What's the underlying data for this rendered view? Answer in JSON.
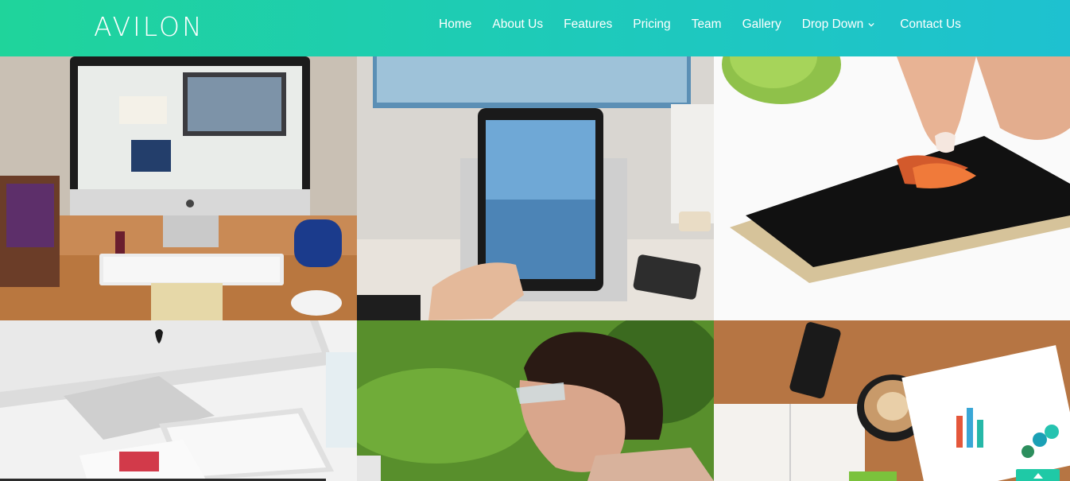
{
  "brand": {
    "name": "AVILON"
  },
  "nav": {
    "items": [
      {
        "label": "Home"
      },
      {
        "label": "About Us"
      },
      {
        "label": "Features"
      },
      {
        "label": "Pricing"
      },
      {
        "label": "Team"
      },
      {
        "label": "Gallery"
      },
      {
        "label": "Drop Down",
        "icon": "chevron-down-icon"
      },
      {
        "label": "Contact Us"
      }
    ]
  },
  "gallery": {
    "photos": [
      {
        "alt": "imac-desk-photo"
      },
      {
        "alt": "ipad-in-hand-photo"
      },
      {
        "alt": "iphone-touch-photo"
      },
      {
        "alt": "imac-keyboard-photo"
      },
      {
        "alt": "woman-sunglasses-photo"
      },
      {
        "alt": "phone-coffee-photo"
      }
    ]
  },
  "colors": {
    "nav_start": "#1fd49b",
    "nav_end": "#1ec1d0",
    "accent": "#1fc9a6"
  },
  "icons": {
    "scroll_top": "chevron-up-icon"
  }
}
